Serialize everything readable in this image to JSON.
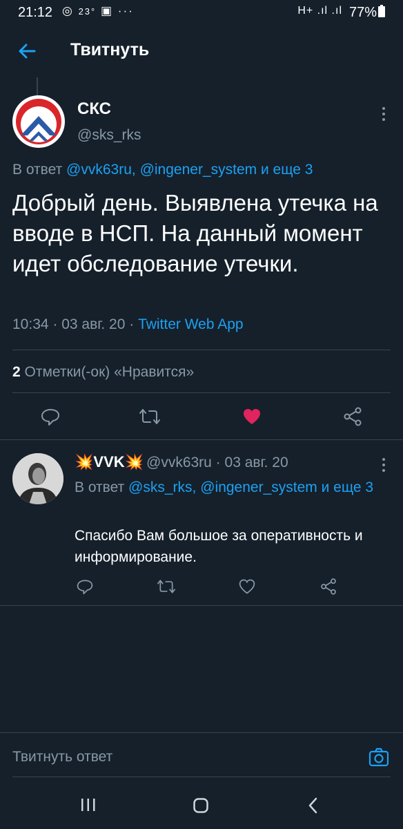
{
  "status_bar": {
    "time": "21:12",
    "icons": [
      "viber-icon",
      "weather-icon",
      "notification-icon",
      "more-dots-icon"
    ],
    "temperature": "23°",
    "network": "H+ .ıl .ıl",
    "battery": "77%"
  },
  "header": {
    "title": "Твитнуть"
  },
  "tweet": {
    "name": "СКС",
    "handle": "@sks_rks",
    "reply_to_prefix": "В ответ",
    "reply_to_users": "@vvk63ru, @ingener_system и еще 3",
    "text": "Добрый день. Выявлена утечка на вводе в НСП. На данный момент идет обследование утечки.",
    "time": "10:34",
    "date": "03 авг. 20",
    "source": "Twitter Web App",
    "likes_count": "2",
    "likes_label": "Отметки(-ок) «Нравится»",
    "liked": true,
    "like_color": "#e0245e"
  },
  "reply": {
    "name": "💥VVK💥",
    "handle_date": "@vvk63ru · 03 авг. 20",
    "reply_to_prefix": "В ответ",
    "reply_to_users": "@sks_rks, @ingener_system и еще 3",
    "text": "Спасибо Вам большое за оперативность и информирование."
  },
  "compose": {
    "placeholder": "Твитнуть ответ"
  },
  "colors": {
    "background": "#15202b",
    "accent": "#1da1f2",
    "muted": "#8899a6",
    "divider": "#38444d"
  }
}
